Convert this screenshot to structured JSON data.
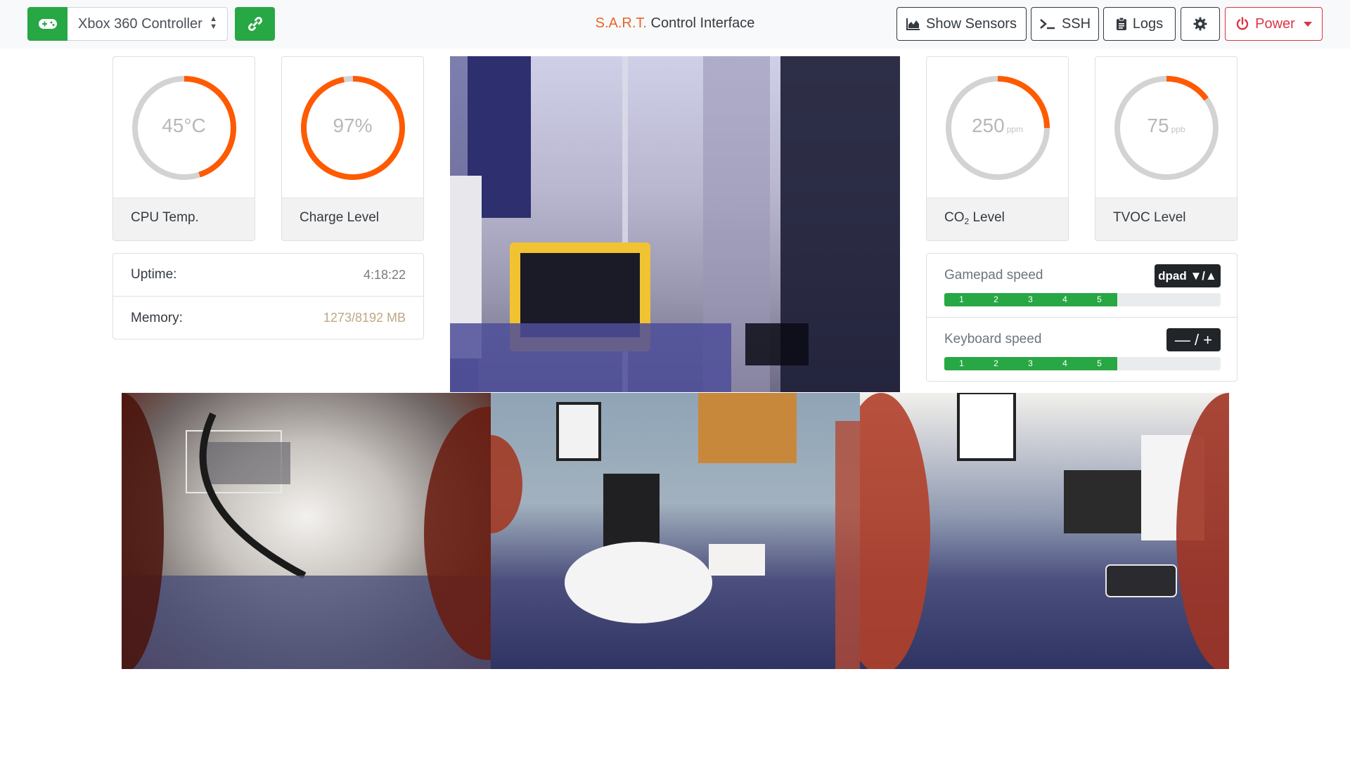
{
  "navbar": {
    "controller_select": {
      "selected": "Xbox 360 Controller",
      "icon": "gamepad-icon"
    },
    "connect_icon": "link-icon",
    "title_brand": "S.A.R.T.",
    "title_rest": " Control Interface",
    "buttons": {
      "sensors": {
        "label": "Show Sensors",
        "icon": "chart-area-icon"
      },
      "ssh": {
        "label": "SSH",
        "icon": "terminal-icon"
      },
      "logs": {
        "label": "Logs",
        "icon": "clipboard-icon"
      },
      "settings": {
        "icon": "gear-icon"
      },
      "power": {
        "label": "Power",
        "icon": "power-icon"
      }
    }
  },
  "gauges": [
    {
      "id": "cpu",
      "value": "45°C",
      "unit": "",
      "label": "CPU Temp.",
      "fraction": 0.45
    },
    {
      "id": "charge",
      "value": "97%",
      "unit": "",
      "label": "Charge Level",
      "fraction": 0.97
    },
    {
      "id": "co2",
      "value": "250",
      "unit": "ppm",
      "label_main": "CO",
      "label_sub": "2",
      "label_tail": " Level",
      "fraction": 0.25
    },
    {
      "id": "tvoc",
      "value": "75",
      "unit": "ppb",
      "label": "TVOC Level",
      "fraction": 0.15
    }
  ],
  "stats": {
    "uptime": {
      "label": "Uptime:",
      "value": "4:18:22"
    },
    "memory": {
      "label": "Memory:",
      "value": "1273/8192 MB"
    }
  },
  "speed": {
    "gamepad": {
      "label": "Gamepad speed",
      "badge": "dpad ▼/▲",
      "levels": [
        "1",
        "2",
        "3",
        "4",
        "5"
      ],
      "level": 5,
      "max": 8
    },
    "keyboard": {
      "label": "Keyboard speed",
      "badge": "— / +",
      "levels": [
        "1",
        "2",
        "3",
        "4",
        "5"
      ],
      "level": 5,
      "max": 8
    }
  },
  "colors": {
    "accent": "#ff5a00",
    "gauge_track": "#d3d3d3",
    "success": "#28a745",
    "danger": "#dc3545",
    "brand": "#e8632b"
  }
}
